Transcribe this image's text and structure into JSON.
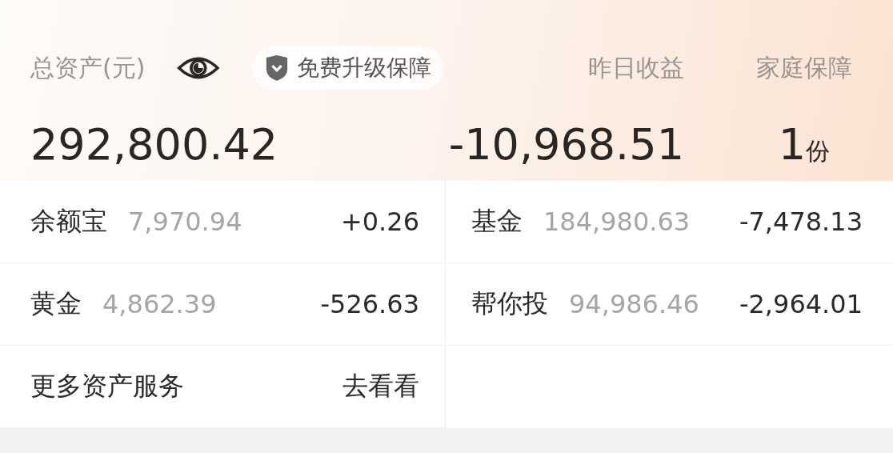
{
  "header": {
    "total_label": "总资产(元)",
    "promo_badge": "免费升级保障",
    "total_value": "292,800.42",
    "yesterday_label": "昨日收益",
    "yesterday_value": "-10,968.51",
    "family_label": "家庭保障",
    "family_count": "1",
    "family_unit": "份"
  },
  "assets": [
    {
      "name": "余额宝",
      "amount": "7,970.94",
      "change": "+0.26"
    },
    {
      "name": "基金",
      "amount": "184,980.63",
      "change": "-7,478.13"
    },
    {
      "name": "黄金",
      "amount": "4,862.39",
      "change": "-526.63"
    },
    {
      "name": "帮你投",
      "amount": "94,986.46",
      "change": "-2,964.01"
    }
  ],
  "more": {
    "label": "更多资产服务",
    "link": "去看看"
  }
}
